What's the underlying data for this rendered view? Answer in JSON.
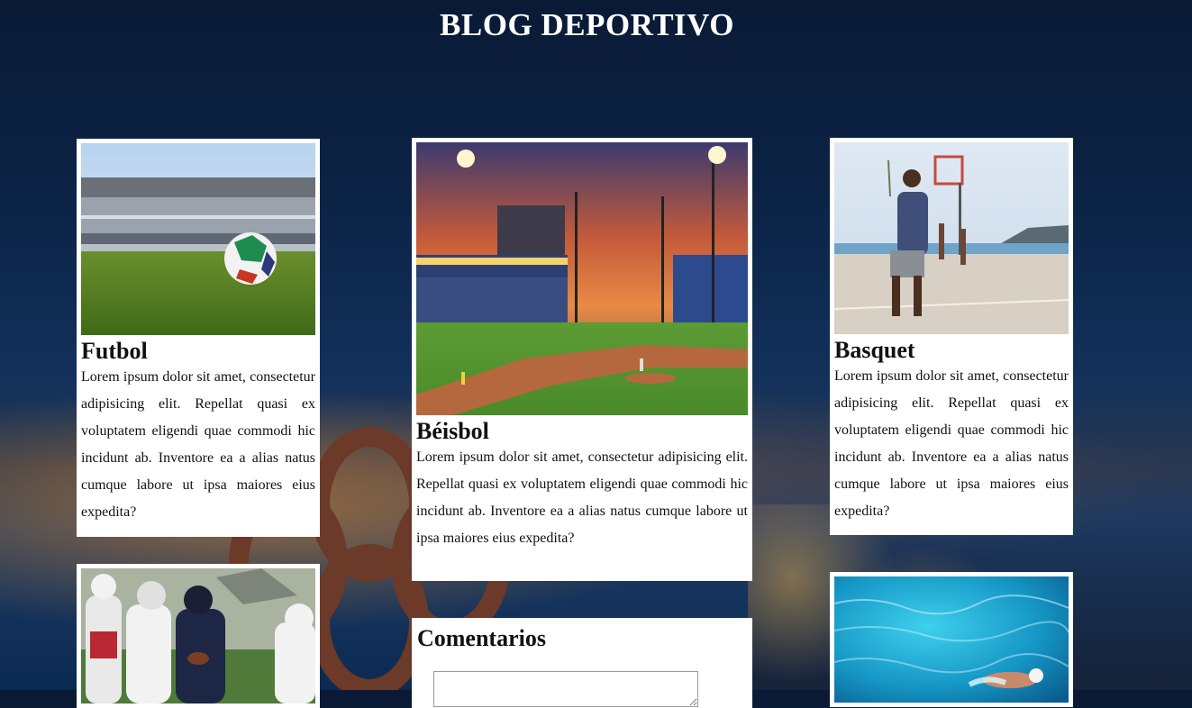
{
  "header": {
    "title": "BLOG DEPORTIVO"
  },
  "posts": [
    {
      "title": "Futbol",
      "text": "Lorem ipsum dolor sit amet, consectetur adipisicing elit. Repellat quasi ex voluptatem eligendi quae commodi hic incidunt ab. Inventore ea a alias natus cumque labore ut ipsa maiores eius expedita?",
      "image": "soccer-ball-stadium-image"
    },
    {
      "title": "Béisbol",
      "text": "Lorem ipsum dolor sit amet, consectetur adipisicing elit. Repellat quasi ex voluptatem eligendi quae commodi hic incidunt ab. Inventore ea a alias natus cumque labore ut ipsa maiores eius expedita?",
      "image": "baseball-stadium-sunset-image"
    },
    {
      "title": "Basquet",
      "text": "Lorem ipsum dolor sit amet, consectetur adipisicing elit. Repellat quasi ex voluptatem eligendi quae commodi hic incidunt ab. Inventore ea a alias natus cumque labore ut ipsa maiores eius expedita?",
      "image": "basketball-court-image"
    },
    {
      "image": "american-football-image"
    },
    {
      "image": "swimming-pool-image"
    }
  ],
  "comments": {
    "title": "Comentarios"
  },
  "colors": {
    "title_text": "#ffffff",
    "card_bg": "#ffffff",
    "text": "#111111"
  }
}
